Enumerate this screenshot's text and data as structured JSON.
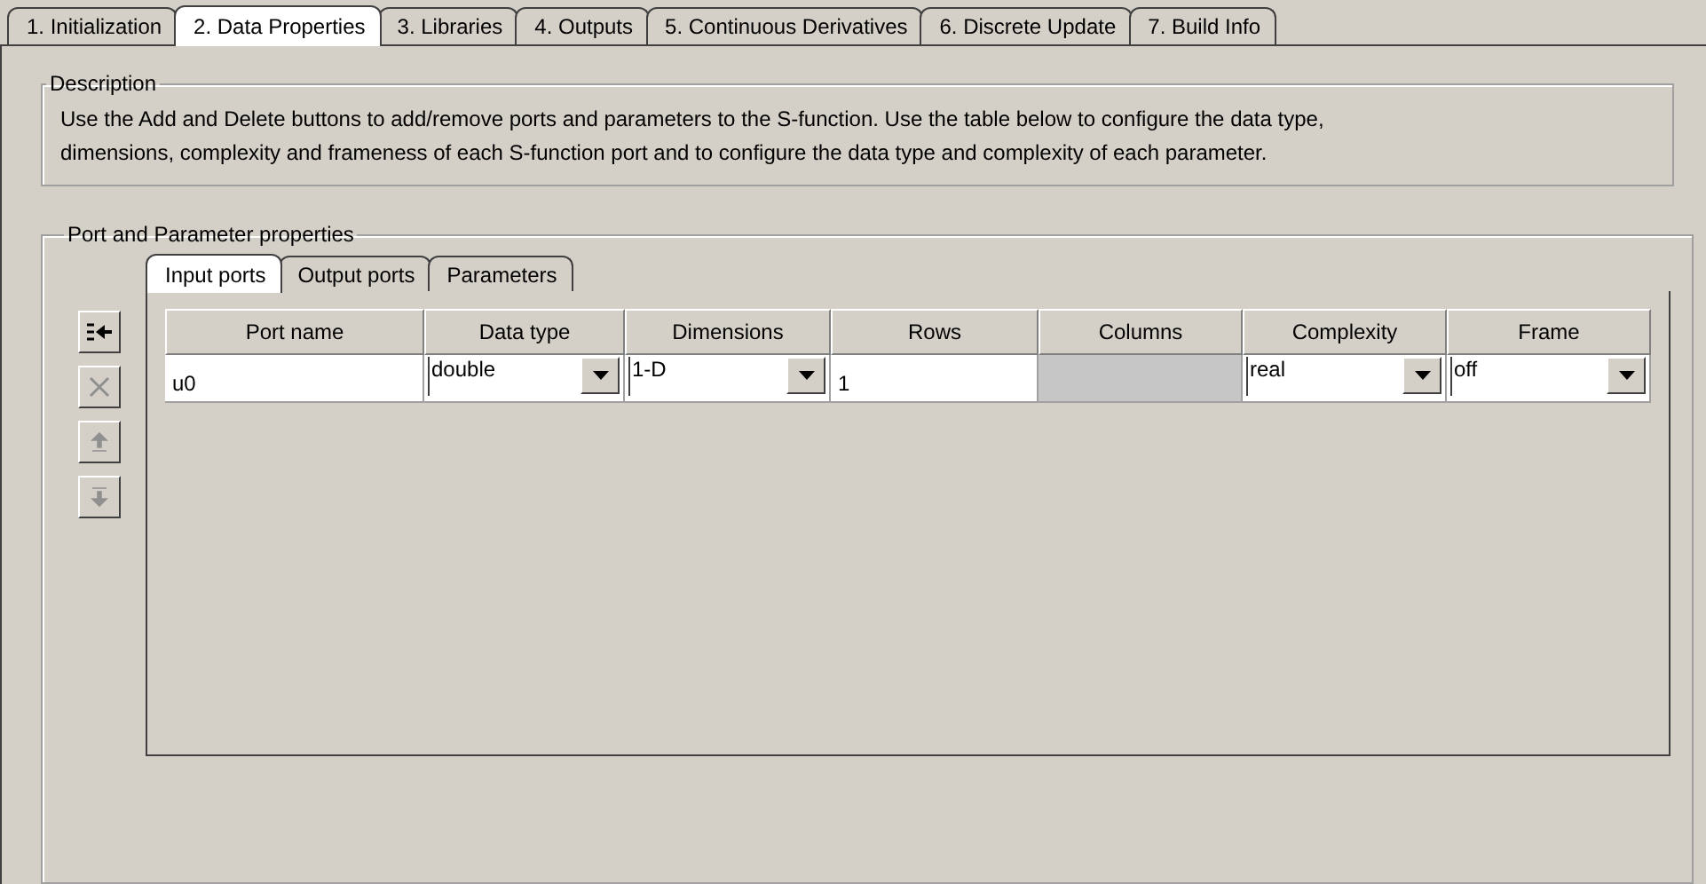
{
  "tabs": [
    {
      "label": "1. Initialization",
      "selected": false
    },
    {
      "label": "2. Data Properties",
      "selected": true
    },
    {
      "label": "3. Libraries",
      "selected": false
    },
    {
      "label": "4. Outputs",
      "selected": false
    },
    {
      "label": "5. Continuous Derivatives",
      "selected": false
    },
    {
      "label": "6. Discrete Update",
      "selected": false
    },
    {
      "label": "7. Build Info",
      "selected": false
    }
  ],
  "description": {
    "title": "Description",
    "text": "Use the Add and Delete buttons to add/remove ports and parameters to the S-function. Use the table below to configure the data type, dimensions, complexity and frameness of each S-function port and to configure the data type and complexity of each parameter."
  },
  "port_properties": {
    "title": "Port and Parameter properties",
    "tabs": [
      {
        "label": "Input ports",
        "selected": true
      },
      {
        "label": "Output ports",
        "selected": false
      },
      {
        "label": "Parameters",
        "selected": false
      }
    ],
    "side_buttons": [
      {
        "kind": "add",
        "disabled": false
      },
      {
        "kind": "delete",
        "disabled": true
      },
      {
        "kind": "up",
        "disabled": true
      },
      {
        "kind": "down",
        "disabled": true
      }
    ],
    "table": {
      "columns": [
        "Port name",
        "Data type",
        "Dimensions",
        "Rows",
        "Columns",
        "Complexity",
        "Frame"
      ],
      "rows": [
        [
          {
            "kind": "text",
            "value": "u0"
          },
          {
            "kind": "dropdown",
            "value": "double"
          },
          {
            "kind": "dropdown",
            "value": "1-D"
          },
          {
            "kind": "text",
            "value": "1"
          },
          {
            "kind": "disabled"
          },
          {
            "kind": "dropdown",
            "value": "real"
          },
          {
            "kind": "dropdown",
            "value": "off"
          }
        ]
      ]
    }
  }
}
